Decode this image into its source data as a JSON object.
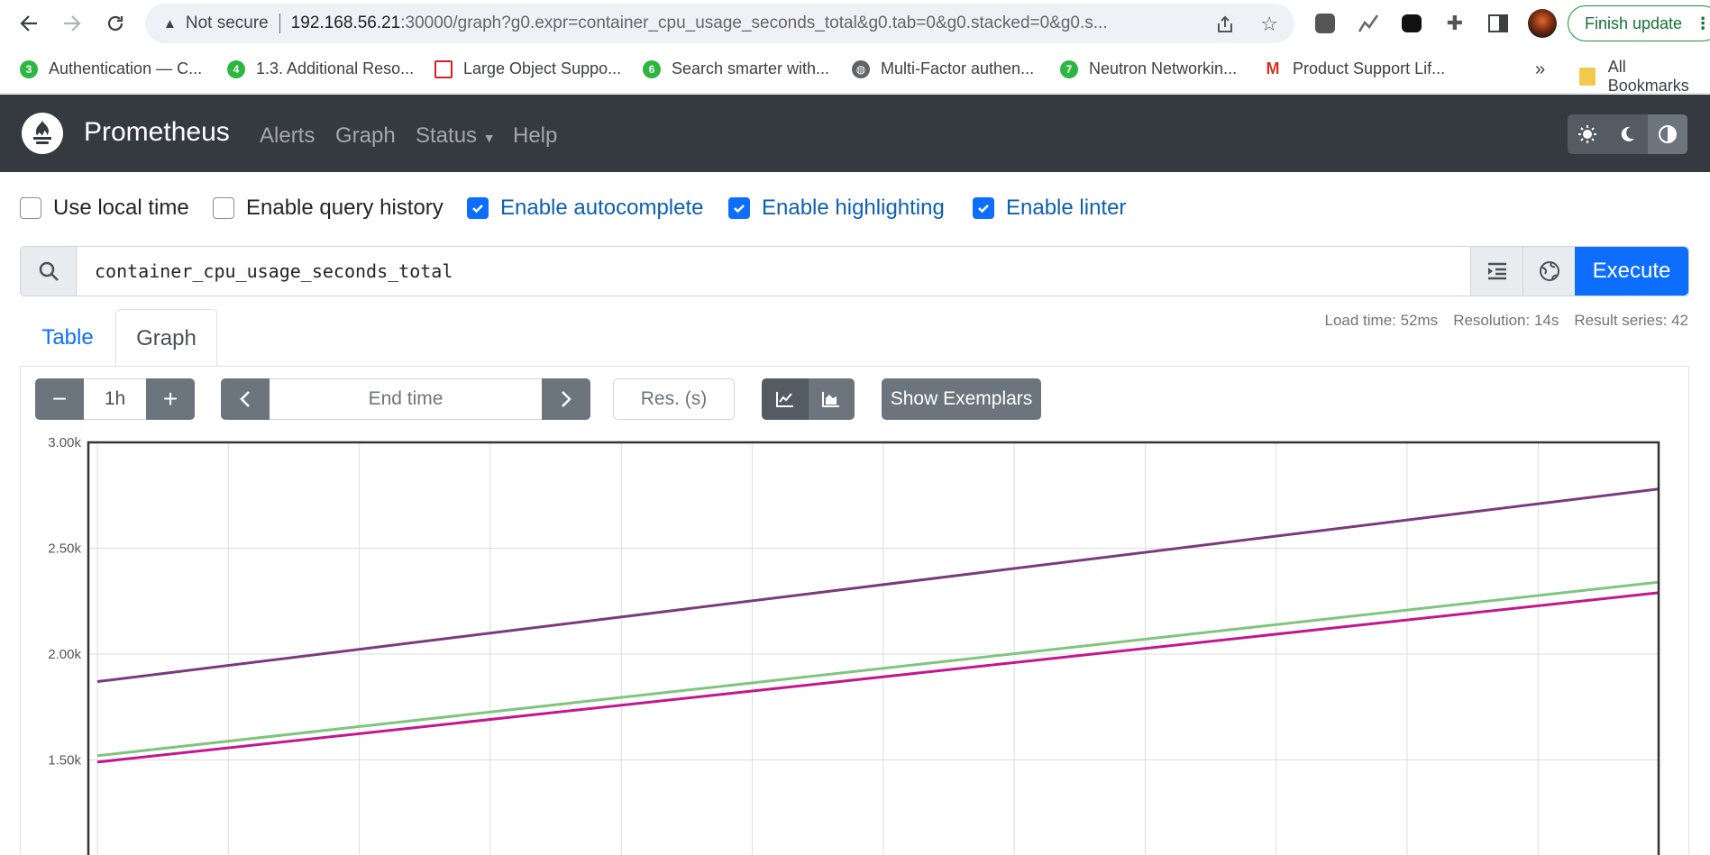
{
  "browser": {
    "security_label": "Not secure",
    "url_host": "192.168.56.21",
    "url_rest": ":30000/graph?g0.expr=container_cpu_usage_seconds_total&g0.tab=0&g0.stacked=0&g0.s...",
    "finish_update": "Finish update",
    "bookmarks": [
      {
        "label": "Authentication — C...",
        "badge": "3",
        "color": "#2db642"
      },
      {
        "label": "1.3. Additional Reso...",
        "badge": "4",
        "color": "#2db642"
      },
      {
        "label": "Large Object Suppo...",
        "badge": "",
        "color": "#d92026"
      },
      {
        "label": "Search smarter with...",
        "badge": "6",
        "color": "#2db642"
      },
      {
        "label": "Multi-Factor authen...",
        "badge": "",
        "color": "#5f6368"
      },
      {
        "label": "Neutron Networkin...",
        "badge": "7",
        "color": "#2db642"
      },
      {
        "label": "Product Support Lif...",
        "badge": "M",
        "color": "#d93025"
      }
    ],
    "bookmarks_more": "»",
    "all_bookmarks": "All Bookmarks"
  },
  "navbar": {
    "brand": "Prometheus",
    "links": [
      "Alerts",
      "Graph",
      "Status",
      "Help"
    ]
  },
  "options": [
    {
      "label": "Use local time",
      "checked": false
    },
    {
      "label": "Enable query history",
      "checked": false
    },
    {
      "label": "Enable autocomplete",
      "checked": true
    },
    {
      "label": "Enable highlighting",
      "checked": true
    },
    {
      "label": "Enable linter",
      "checked": true
    }
  ],
  "query": {
    "expression": "container_cpu_usage_seconds_total",
    "execute_label": "Execute"
  },
  "tabs": {
    "table": "Table",
    "graph": "Graph",
    "active": "graph"
  },
  "stats": {
    "load_time": "Load time: 52ms",
    "resolution": "Resolution: 14s",
    "result_series": "Result series: 42"
  },
  "graph_controls": {
    "range": "1h",
    "end_time_placeholder": "End time",
    "resolution_placeholder": "Res. (s)",
    "show_exemplars": "Show Exemplars",
    "stacked": false
  },
  "chart_data": {
    "type": "line",
    "title": "",
    "xlabel": "",
    "ylabel": "",
    "y_ticks": [
      "3.00k",
      "2.50k",
      "2.00k",
      "1.50k"
    ],
    "ylim": [
      1000,
      3000
    ],
    "grid": true,
    "x_range": [
      0,
      1
    ],
    "series": [
      {
        "color": "#7b3a7e",
        "x": [
          0,
          1
        ],
        "values": [
          1870,
          2780
        ]
      },
      {
        "color": "#7ec67e",
        "x": [
          0,
          1
        ],
        "values": [
          1520,
          2340
        ]
      },
      {
        "color": "#c4168d",
        "x": [
          0,
          1
        ],
        "values": [
          1490,
          2290
        ]
      }
    ]
  }
}
